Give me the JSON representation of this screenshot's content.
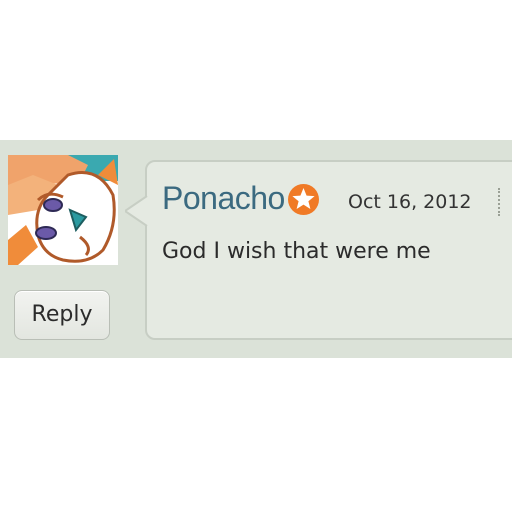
{
  "comment": {
    "avatar_icon": "fox-character-avatar-icon",
    "username": "Ponacho",
    "badge_icon": "star-badge-icon",
    "timestamp": "Oct 16, 2012",
    "text": "God I wish that were me",
    "reply_label": "Reply",
    "more_icon": "dotted-overflow-icon"
  },
  "colors": {
    "band_background": "#dbe2d8",
    "bubble_background": "#e5eae2",
    "bubble_border": "#c7cec4",
    "username": "#3b6a80",
    "badge": "#f07a26"
  }
}
